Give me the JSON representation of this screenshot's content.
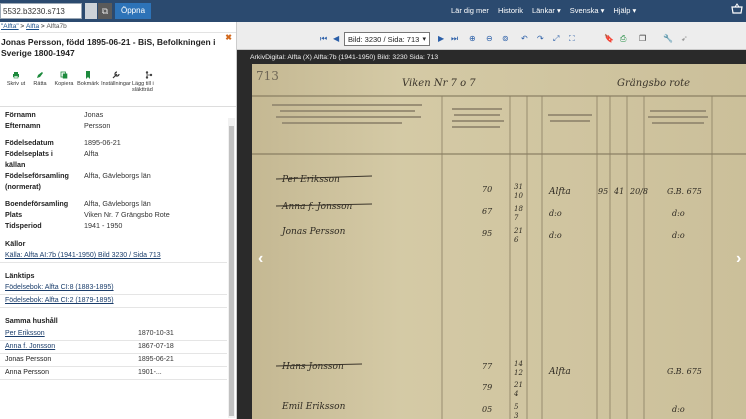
{
  "topbar": {
    "search_value": "5532.b3230.s713",
    "open_label": "Öppna",
    "nav": [
      "Lär dig mer",
      "Historik",
      "Länkar ▾",
      "Svenska ▾",
      "Hjälp ▾"
    ]
  },
  "breadcrumb": [
    "\"Alfta\"",
    "Alfta",
    "Alfta7b"
  ],
  "panel": {
    "title": "Jonas Persson, född 1895-06-21 - BiS, Befolkningen i Sverige 1800-1947",
    "actions": [
      "Skriv ut",
      "Rätta",
      "Kopiera",
      "Bokmärk",
      "Inställningar",
      "Lägg till i släktträd"
    ],
    "fields": [
      {
        "k": "Förnamn",
        "v": "Jonas"
      },
      {
        "k": "Efternamn",
        "v": "Persson"
      },
      {
        "k": "",
        "v": ""
      },
      {
        "k": "Födelsedatum",
        "v": "1895-06-21"
      },
      {
        "k": "Födelseplats i",
        "v": "Alfta"
      },
      {
        "k": "källan",
        "v": ""
      },
      {
        "k": "Födelseförsamling",
        "v": "Alfta, Gävleborgs län"
      },
      {
        "k": "(normerat)",
        "v": ""
      },
      {
        "k": "",
        "v": ""
      },
      {
        "k": "Boendeförsamling",
        "v": "Alfta, Gävleborgs län"
      },
      {
        "k": "Plats",
        "v": "Viken Nr. 7 Grängsbo Rote"
      },
      {
        "k": "Tidsperiod",
        "v": "1941 - 1950"
      }
    ],
    "sources_h": "Källor",
    "sources": [
      "Källa: Alfta AI:7b (1941-1950) Bild 3230 / Sida 713"
    ],
    "links_h": "Länktips",
    "links": [
      "Födelsebok: Alfta CI:8 (1883-1895)",
      "Födelsebok: Alfta CI:2 (1879-1895)"
    ],
    "household_h": "Samma hushåll",
    "household": [
      {
        "n": "Per Eriksson",
        "d": "1870-10-31",
        "link": true
      },
      {
        "n": "Anna f. Jonsson",
        "d": "1867-07-18",
        "link": true
      },
      {
        "n": "Jonas Persson",
        "d": "1895-06-21",
        "link": false
      },
      {
        "n": "Anna Persson",
        "d": "1901-...",
        "link": false
      }
    ]
  },
  "viewer": {
    "page_select": "Bild: 3230 / Sida: 713",
    "caption": "ArkivDigital: Alfta (X) Alfta:7b (1941-1950) Bild: 3230 Sida: 713"
  },
  "document": {
    "page_no": "713",
    "header_place": "Viken Nr 7 o 7",
    "header_rote": "Grängsbo rote",
    "entries": [
      {
        "name": "Per Eriksson",
        "year": "70",
        "day": "31",
        "month": "10",
        "place": "Alfta",
        "yr_m": "95",
        "m1": "41",
        "m2": "20/8",
        "out": "G.B. 675"
      },
      {
        "name": "Anna f. Jonsson",
        "year": "67",
        "day": "18",
        "month": "7",
        "place": "d:o",
        "yr_m": "",
        "m1": "",
        "m2": "",
        "out": "d:o"
      },
      {
        "name": "Jonas Persson",
        "year": "95",
        "day": "21",
        "month": "6",
        "place": "d:o",
        "yr_m": "",
        "m1": "",
        "m2": "",
        "out": "d:o"
      }
    ],
    "entries2": [
      {
        "name": "Hans Jonsson",
        "year": "77",
        "day": "14",
        "month": "12",
        "place": "Alfta",
        "out": "G.B. 675"
      },
      {
        "name": "",
        "year": "79",
        "day": "21",
        "month": "4",
        "place": "",
        "out": ""
      },
      {
        "name": "Emil Eriksson",
        "year": "05",
        "day": "5",
        "month": "3",
        "place": "",
        "out": "d:o"
      }
    ]
  }
}
